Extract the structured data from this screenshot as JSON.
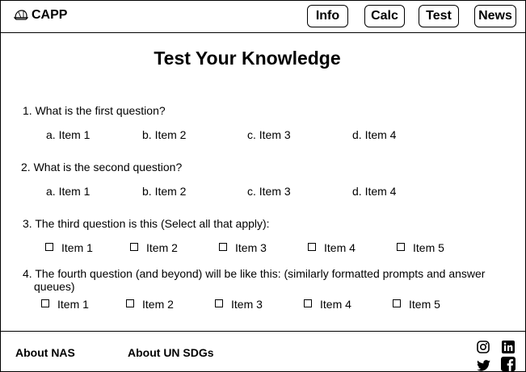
{
  "header": {
    "brand": "CAPP",
    "nav": [
      "Info",
      "Calc",
      "Test",
      "News"
    ]
  },
  "main": {
    "title": "Test Your Knowledge",
    "questions": [
      {
        "prompt": "1. What is the first question?",
        "options": [
          "a. Item 1",
          "b. Item 2",
          "c. Item 3",
          "d. Item 4"
        ]
      },
      {
        "prompt": "2. What is the second question?",
        "options": [
          "a. Item 1",
          "b. Item 2",
          "c. Item 3",
          "d. Item 4"
        ]
      },
      {
        "prompt": "3. The third question is this (Select all that apply):",
        "options": [
          "Item 1",
          "Item 2",
          "Item 3",
          "Item 4",
          "Item 5"
        ]
      },
      {
        "prompt_line1": "4. The fourth question (and beyond) will be like this: (similarly formatted prompts and answer",
        "prompt_line2": "queues)",
        "options": [
          "Item 1",
          "Item 2",
          "Item 3",
          "Item 4",
          "Item 5"
        ]
      }
    ]
  },
  "footer": {
    "links": [
      "About NAS",
      "About UN SDGs"
    ],
    "social_icons": [
      "instagram-icon",
      "linkedin-icon",
      "twitter-icon",
      "facebook-icon"
    ]
  }
}
